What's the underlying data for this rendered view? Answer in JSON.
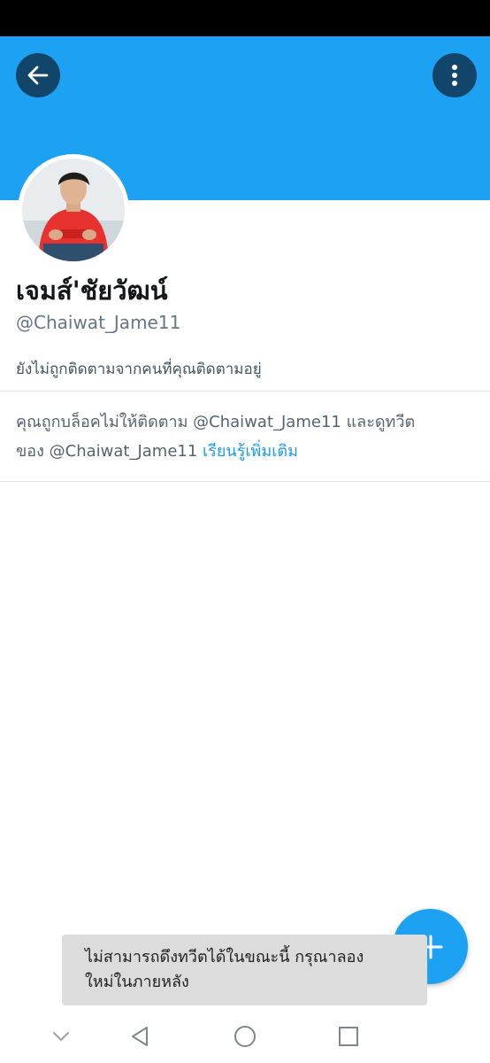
{
  "profile": {
    "display_name": "เจมส์'ชัยวัฒน์",
    "handle": "@Chaiwat_Jame11",
    "follow_status": "ยังไม่ถูกติดตามจากคนที่คุณติดตามอยู่",
    "avatar": "profile-photo"
  },
  "blocked_notice": {
    "text_line1": "คุณถูกบล็อคไม่ให้ติดตาม @Chaiwat_Jame11 และดูทวีต",
    "text_line2": "ของ @Chaiwat_Jame11",
    "learn_more": "เรียนรู้เพิ่มเติม"
  },
  "toast": {
    "message_line1": "ไม่สามารถดึงทวีตได้ในขณะนี้ กรุณาลอง",
    "message_line2": "ใหม่ในภายหลัง"
  },
  "icons": {
    "back": "arrow-left-icon",
    "more": "more-vertical-icon",
    "compose": "plus-icon",
    "nav_hide": "chevron-down-icon",
    "nav_back": "triangle-back-icon",
    "nav_home": "circle-home-icon",
    "nav_recents": "square-recents-icon"
  },
  "colors": {
    "brand": "#1da1f2",
    "header_button": "#12456a",
    "link": "#1d9bf0",
    "toast_bg": "#dcdcdc"
  }
}
